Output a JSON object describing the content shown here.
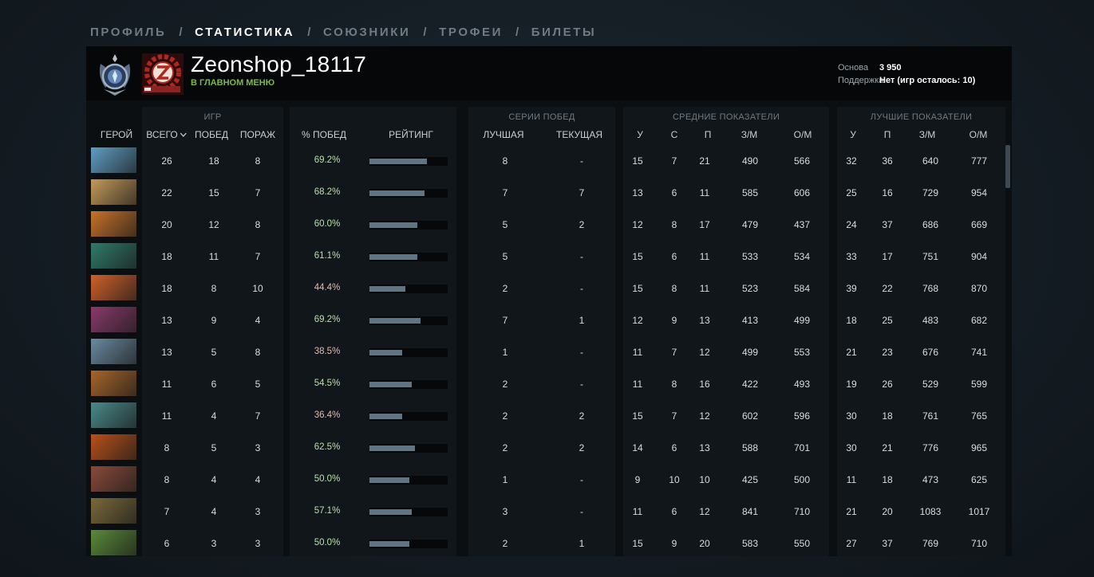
{
  "nav": {
    "tabs": [
      "ПРОФИЛЬ",
      "СТАТИСТИКА",
      "СОЮЗНИКИ",
      "ТРОФЕИ",
      "БИЛЕТЫ"
    ],
    "active": "СТАТИСТИКА"
  },
  "profile": {
    "username": "Zeonshop_18117",
    "status": "В ГЛАВНОМ МЕНЮ",
    "main_label": "Основа",
    "main_value": "3 950",
    "support_label": "Поддержка",
    "support_value": "Нет (игр осталось: 10)"
  },
  "groups": {
    "games": "ИГР",
    "streaks": "СЕРИИ ПОБЕД",
    "averages": "СРЕДНИЕ ПОКАЗАТЕЛИ",
    "best": "ЛУЧШИЕ ПОКАЗАТЕЛИ"
  },
  "columns": {
    "hero": "ГЕРОЙ",
    "total": "ВСЕГО",
    "wins": "ПОБЕД",
    "losses": "ПОРАЖ",
    "winrate": "% ПОБЕД",
    "rating": "РЕЙТИНГ",
    "best_streak": "ЛУЧШАЯ",
    "current_streak": "ТЕКУЩАЯ",
    "avg_k": "У",
    "avg_d": "С",
    "avg_a": "П",
    "avg_gpm": "З/М",
    "avg_xpm": "О/М",
    "best_k": "У",
    "best_a": "П",
    "best_gpm": "З/М",
    "best_xpm": "О/М"
  },
  "rows": [
    {
      "hero_color": "#5f9ec4",
      "total": "26",
      "wins": "18",
      "losses": "8",
      "winrate": "69.2%",
      "rating": 0.73,
      "best_streak": "8",
      "current_streak": "-",
      "k": "15",
      "d": "7",
      "a": "21",
      "gpm": "490",
      "xpm": "566",
      "bk": "32",
      "ba": "36",
      "bgpm": "640",
      "bxpm": "777"
    },
    {
      "hero_color": "#c49a5a",
      "total": "22",
      "wins": "15",
      "losses": "7",
      "winrate": "68.2%",
      "rating": 0.7,
      "best_streak": "7",
      "current_streak": "7",
      "k": "13",
      "d": "6",
      "a": "11",
      "gpm": "585",
      "xpm": "606",
      "bk": "25",
      "ba": "16",
      "bgpm": "729",
      "bxpm": "954"
    },
    {
      "hero_color": "#c8722a",
      "total": "20",
      "wins": "12",
      "losses": "8",
      "winrate": "60.0%",
      "rating": 0.61,
      "best_streak": "5",
      "current_streak": "2",
      "k": "12",
      "d": "8",
      "a": "17",
      "gpm": "479",
      "xpm": "437",
      "bk": "24",
      "ba": "37",
      "bgpm": "686",
      "bxpm": "669"
    },
    {
      "hero_color": "#2f7a6a",
      "total": "18",
      "wins": "11",
      "losses": "7",
      "winrate": "61.1%",
      "rating": 0.61,
      "best_streak": "5",
      "current_streak": "-",
      "k": "15",
      "d": "6",
      "a": "11",
      "gpm": "533",
      "xpm": "534",
      "bk": "33",
      "ba": "17",
      "bgpm": "751",
      "bxpm": "904"
    },
    {
      "hero_color": "#d0602a",
      "total": "18",
      "wins": "8",
      "losses": "10",
      "winrate": "44.4%",
      "rating": 0.46,
      "best_streak": "2",
      "current_streak": "-",
      "k": "15",
      "d": "8",
      "a": "11",
      "gpm": "523",
      "xpm": "584",
      "bk": "39",
      "ba": "22",
      "bgpm": "768",
      "bxpm": "870"
    },
    {
      "hero_color": "#8a3a6a",
      "total": "13",
      "wins": "9",
      "losses": "4",
      "winrate": "69.2%",
      "rating": 0.65,
      "best_streak": "7",
      "current_streak": "1",
      "k": "12",
      "d": "9",
      "a": "13",
      "gpm": "413",
      "xpm": "499",
      "bk": "18",
      "ba": "25",
      "bgpm": "483",
      "bxpm": "682"
    },
    {
      "hero_color": "#6a8aa0",
      "total": "13",
      "wins": "5",
      "losses": "8",
      "winrate": "38.5%",
      "rating": 0.42,
      "best_streak": "1",
      "current_streak": "-",
      "k": "11",
      "d": "7",
      "a": "12",
      "gpm": "499",
      "xpm": "553",
      "bk": "21",
      "ba": "23",
      "bgpm": "676",
      "bxpm": "741"
    },
    {
      "hero_color": "#a8652a",
      "total": "11",
      "wins": "6",
      "losses": "5",
      "winrate": "54.5%",
      "rating": 0.54,
      "best_streak": "2",
      "current_streak": "-",
      "k": "11",
      "d": "8",
      "a": "16",
      "gpm": "422",
      "xpm": "493",
      "bk": "19",
      "ba": "26",
      "bgpm": "529",
      "bxpm": "599"
    },
    {
      "hero_color": "#4a8a8a",
      "total": "11",
      "wins": "4",
      "losses": "7",
      "winrate": "36.4%",
      "rating": 0.42,
      "best_streak": "2",
      "current_streak": "2",
      "k": "15",
      "d": "7",
      "a": "12",
      "gpm": "602",
      "xpm": "596",
      "bk": "30",
      "ba": "18",
      "bgpm": "761",
      "bxpm": "765"
    },
    {
      "hero_color": "#b8501a",
      "total": "8",
      "wins": "5",
      "losses": "3",
      "winrate": "62.5%",
      "rating": 0.58,
      "best_streak": "2",
      "current_streak": "2",
      "k": "14",
      "d": "6",
      "a": "13",
      "gpm": "588",
      "xpm": "701",
      "bk": "30",
      "ba": "21",
      "bgpm": "776",
      "bxpm": "965"
    },
    {
      "hero_color": "#8a4a3a",
      "total": "8",
      "wins": "4",
      "losses": "4",
      "winrate": "50.0%",
      "rating": 0.51,
      "best_streak": "1",
      "current_streak": "-",
      "k": "9",
      "d": "10",
      "a": "10",
      "gpm": "425",
      "xpm": "500",
      "bk": "11",
      "ba": "18",
      "bgpm": "473",
      "bxpm": "625"
    },
    {
      "hero_color": "#7a6a3a",
      "total": "7",
      "wins": "4",
      "losses": "3",
      "winrate": "57.1%",
      "rating": 0.54,
      "best_streak": "3",
      "current_streak": "-",
      "k": "11",
      "d": "6",
      "a": "12",
      "gpm": "841",
      "xpm": "710",
      "bk": "21",
      "ba": "20",
      "bgpm": "1083",
      "bxpm": "1017"
    },
    {
      "hero_color": "#5a8a3a",
      "total": "6",
      "wins": "3",
      "losses": "3",
      "winrate": "50.0%",
      "rating": 0.51,
      "best_streak": "2",
      "current_streak": "1",
      "k": "15",
      "d": "9",
      "a": "20",
      "gpm": "583",
      "xpm": "550",
      "bk": "27",
      "ba": "37",
      "bgpm": "769",
      "bxpm": "710"
    }
  ]
}
